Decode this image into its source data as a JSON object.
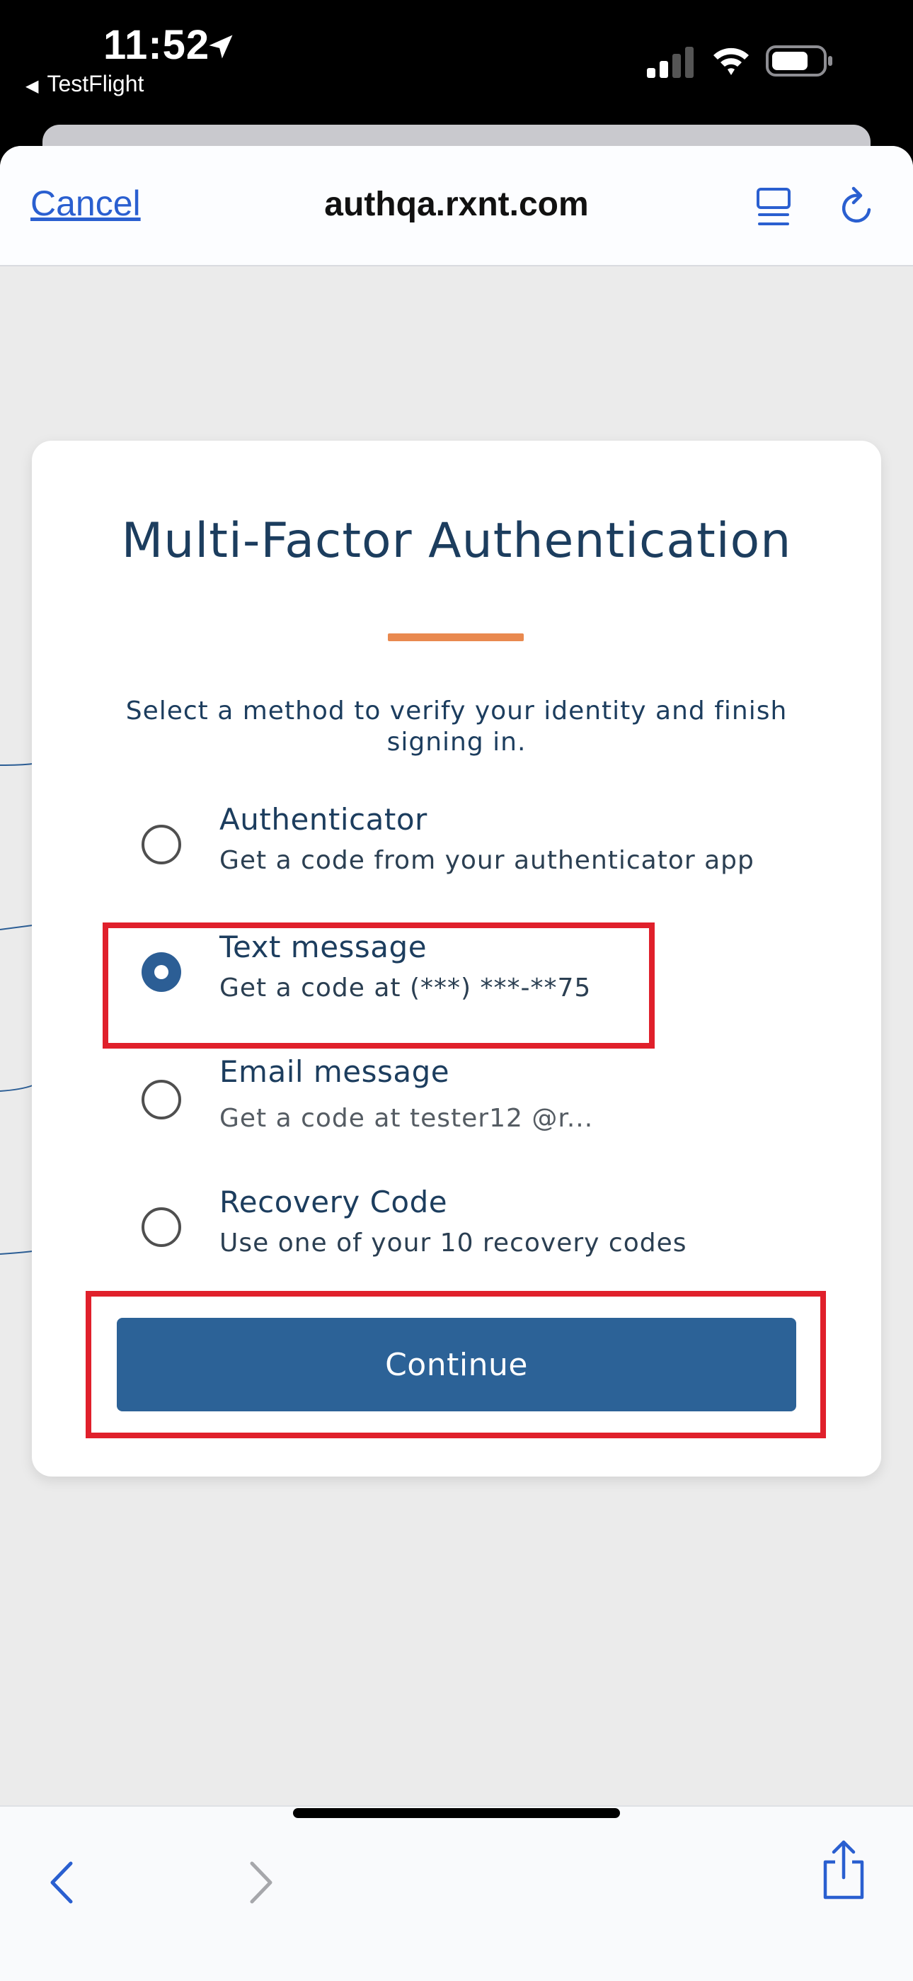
{
  "status_bar": {
    "time": "11:52",
    "back_app": "TestFlight"
  },
  "browser": {
    "cancel_label": "Cancel",
    "url": "authqa.rxnt.com"
  },
  "card": {
    "title": "Multi-Factor Authentication",
    "subtitle": "Select a method to verify your identity and finish signing in.",
    "options": [
      {
        "label": "Authenticator",
        "description": "Get a code from your authenticator app",
        "selected": false
      },
      {
        "label": "Text message",
        "description": "Get a code at (***) ***-**75",
        "selected": true
      },
      {
        "label": "Email message",
        "description": "Get a code at  tester12 @r...",
        "selected": false
      },
      {
        "label": "Recovery Code",
        "description": "Use one of your 10 recovery codes",
        "selected": false
      }
    ],
    "continue_label": "Continue"
  },
  "colors": {
    "accent": "#2c6297",
    "title_text": "#1c3d5e",
    "underline": "#e9894f",
    "highlight": "#e0202b",
    "link": "#2a5fd0"
  },
  "icons": [
    "location-arrow-icon",
    "signal-icon",
    "wifi-icon",
    "battery-icon",
    "reader-mode-icon",
    "reload-icon",
    "chevron-left-icon",
    "chevron-right-icon",
    "share-icon"
  ]
}
